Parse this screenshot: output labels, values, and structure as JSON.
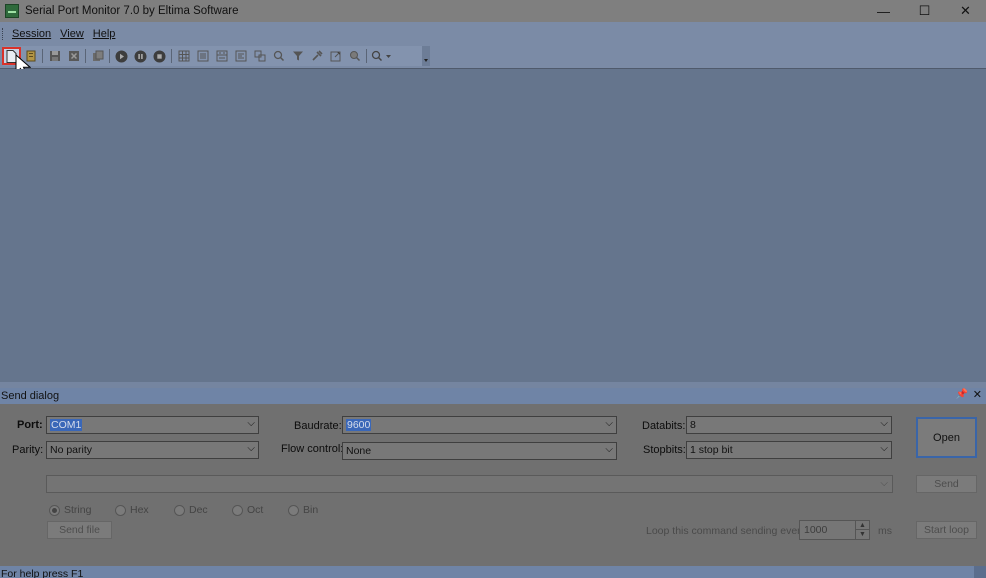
{
  "window": {
    "title": "Serial Port Monitor 7.0 by Eltima Software",
    "minimize": "—",
    "maximize": "☐",
    "close": "✕"
  },
  "menu": [
    {
      "label": "Session"
    },
    {
      "label": "View"
    },
    {
      "label": "Help"
    }
  ],
  "toolbar": {
    "icons": [
      "new-session-icon",
      "open-session-icon",
      "save-icon",
      "close-session-icon",
      "copy-icon",
      "play-icon",
      "pause-icon",
      "stop-icon",
      "table-view-icon",
      "line-view-icon",
      "dump-view-icon",
      "terminal-view-icon",
      "modbus-view-icon",
      "search-icon",
      "filter-icon",
      "tools-icon",
      "export-icon",
      "zoom-icon",
      "find-icon"
    ]
  },
  "send_dialog": {
    "title": "Send dialog",
    "port_label": "Port:",
    "port_value": "COM1",
    "parity_label": "Parity:",
    "parity_value": "No parity",
    "baudrate_label": "Baudrate:",
    "baudrate_value": "9600",
    "flow_label": "Flow control:",
    "flow_value": "None",
    "databits_label": "Databits:",
    "databits_value": "8",
    "stopbits_label": "Stopbits:",
    "stopbits_value": "1 stop bit",
    "open_label": "Open",
    "send_label": "Send",
    "send_file_label": "Send file",
    "formats": [
      "String",
      "Hex",
      "Dec",
      "Oct",
      "Bin"
    ],
    "selected_format": "String",
    "loop_label": "Loop this command sending every",
    "loop_value": "1000",
    "loop_unit": "ms",
    "start_loop_label": "Start loop"
  },
  "status": {
    "text": "For help press F1"
  }
}
